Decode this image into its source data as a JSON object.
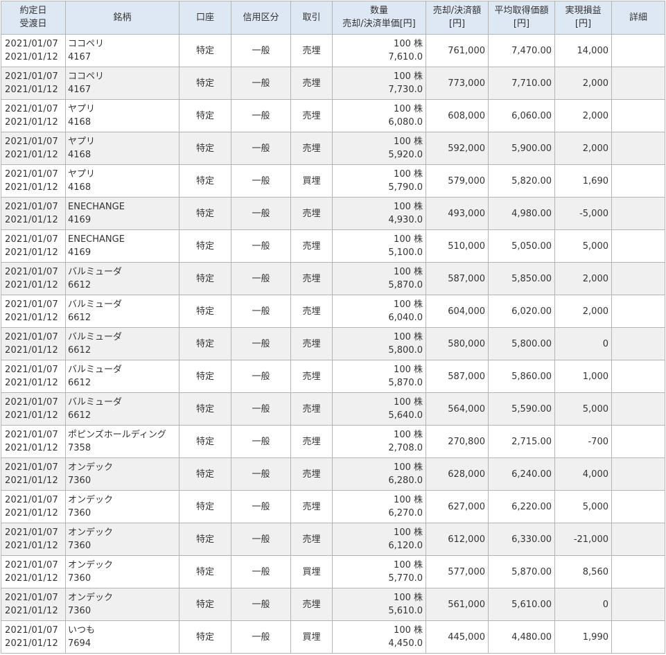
{
  "header": {
    "date_1": "約定日",
    "date_2": "受渡日",
    "name": "銘柄",
    "account": "口座",
    "credit": "信用区分",
    "trade": "取引",
    "qty_1": "数量",
    "qty_2": "売却/決済単価[円]",
    "amount_1": "売却/決済額",
    "amount_2": "[円]",
    "avg_1": "平均取得価額",
    "avg_2": "[円]",
    "pl_1": "実現損益",
    "pl_2": "[円]",
    "detail": "詳細"
  },
  "rows": [
    {
      "trade_date": "2021/01/07",
      "settle_date": "2021/01/12",
      "name": "ココペリ",
      "code": "4167",
      "account": "特定",
      "credit": "一般",
      "type": "売埋",
      "qty": "100 株",
      "price": "7,610.0",
      "amount": "761,000",
      "avg": "7,470.00",
      "pl": "14,000",
      "detail": ""
    },
    {
      "trade_date": "2021/01/07",
      "settle_date": "2021/01/12",
      "name": "ココペリ",
      "code": "4167",
      "account": "特定",
      "credit": "一般",
      "type": "売埋",
      "qty": "100 株",
      "price": "7,730.0",
      "amount": "773,000",
      "avg": "7,710.00",
      "pl": "2,000",
      "detail": ""
    },
    {
      "trade_date": "2021/01/07",
      "settle_date": "2021/01/12",
      "name": "ヤプリ",
      "code": "4168",
      "account": "特定",
      "credit": "一般",
      "type": "売埋",
      "qty": "100 株",
      "price": "6,080.0",
      "amount": "608,000",
      "avg": "6,060.00",
      "pl": "2,000",
      "detail": ""
    },
    {
      "trade_date": "2021/01/07",
      "settle_date": "2021/01/12",
      "name": "ヤプリ",
      "code": "4168",
      "account": "特定",
      "credit": "一般",
      "type": "売埋",
      "qty": "100 株",
      "price": "5,920.0",
      "amount": "592,000",
      "avg": "5,900.00",
      "pl": "2,000",
      "detail": ""
    },
    {
      "trade_date": "2021/01/07",
      "settle_date": "2021/01/12",
      "name": "ヤプリ",
      "code": "4168",
      "account": "特定",
      "credit": "一般",
      "type": "買埋",
      "qty": "100 株",
      "price": "5,790.0",
      "amount": "579,000",
      "avg": "5,820.00",
      "pl": "1,690",
      "detail": ""
    },
    {
      "trade_date": "2021/01/07",
      "settle_date": "2021/01/12",
      "name": "ENECHANGE",
      "code": "4169",
      "account": "特定",
      "credit": "一般",
      "type": "売埋",
      "qty": "100 株",
      "price": "4,930.0",
      "amount": "493,000",
      "avg": "4,980.00",
      "pl": "-5,000",
      "detail": ""
    },
    {
      "trade_date": "2021/01/07",
      "settle_date": "2021/01/12",
      "name": "ENECHANGE",
      "code": "4169",
      "account": "特定",
      "credit": "一般",
      "type": "売埋",
      "qty": "100 株",
      "price": "5,100.0",
      "amount": "510,000",
      "avg": "5,050.00",
      "pl": "5,000",
      "detail": ""
    },
    {
      "trade_date": "2021/01/07",
      "settle_date": "2021/01/12",
      "name": "バルミューダ",
      "code": "6612",
      "account": "特定",
      "credit": "一般",
      "type": "売埋",
      "qty": "100 株",
      "price": "5,870.0",
      "amount": "587,000",
      "avg": "5,850.00",
      "pl": "2,000",
      "detail": ""
    },
    {
      "trade_date": "2021/01/07",
      "settle_date": "2021/01/12",
      "name": "バルミューダ",
      "code": "6612",
      "account": "特定",
      "credit": "一般",
      "type": "売埋",
      "qty": "100 株",
      "price": "6,040.0",
      "amount": "604,000",
      "avg": "6,020.00",
      "pl": "2,000",
      "detail": ""
    },
    {
      "trade_date": "2021/01/07",
      "settle_date": "2021/01/12",
      "name": "バルミューダ",
      "code": "6612",
      "account": "特定",
      "credit": "一般",
      "type": "売埋",
      "qty": "100 株",
      "price": "5,800.0",
      "amount": "580,000",
      "avg": "5,800.00",
      "pl": "0",
      "detail": ""
    },
    {
      "trade_date": "2021/01/07",
      "settle_date": "2021/01/12",
      "name": "バルミューダ",
      "code": "6612",
      "account": "特定",
      "credit": "一般",
      "type": "売埋",
      "qty": "100 株",
      "price": "5,870.0",
      "amount": "587,000",
      "avg": "5,860.00",
      "pl": "1,000",
      "detail": ""
    },
    {
      "trade_date": "2021/01/07",
      "settle_date": "2021/01/12",
      "name": "バルミューダ",
      "code": "6612",
      "account": "特定",
      "credit": "一般",
      "type": "売埋",
      "qty": "100 株",
      "price": "5,640.0",
      "amount": "564,000",
      "avg": "5,590.00",
      "pl": "5,000",
      "detail": ""
    },
    {
      "trade_date": "2021/01/07",
      "settle_date": "2021/01/12",
      "name": "ポピンズホールディング",
      "code": "7358",
      "account": "特定",
      "credit": "一般",
      "type": "売埋",
      "qty": "100 株",
      "price": "2,708.0",
      "amount": "270,800",
      "avg": "2,715.00",
      "pl": "-700",
      "detail": ""
    },
    {
      "trade_date": "2021/01/07",
      "settle_date": "2021/01/12",
      "name": "オンデック",
      "code": "7360",
      "account": "特定",
      "credit": "一般",
      "type": "売埋",
      "qty": "100 株",
      "price": "6,280.0",
      "amount": "628,000",
      "avg": "6,240.00",
      "pl": "4,000",
      "detail": ""
    },
    {
      "trade_date": "2021/01/07",
      "settle_date": "2021/01/12",
      "name": "オンデック",
      "code": "7360",
      "account": "特定",
      "credit": "一般",
      "type": "売埋",
      "qty": "100 株",
      "price": "6,270.0",
      "amount": "627,000",
      "avg": "6,220.00",
      "pl": "5,000",
      "detail": ""
    },
    {
      "trade_date": "2021/01/07",
      "settle_date": "2021/01/12",
      "name": "オンデック",
      "code": "7360",
      "account": "特定",
      "credit": "一般",
      "type": "売埋",
      "qty": "100 株",
      "price": "6,120.0",
      "amount": "612,000",
      "avg": "6,330.00",
      "pl": "-21,000",
      "detail": ""
    },
    {
      "trade_date": "2021/01/07",
      "settle_date": "2021/01/12",
      "name": "オンデック",
      "code": "7360",
      "account": "特定",
      "credit": "一般",
      "type": "買埋",
      "qty": "100 株",
      "price": "5,770.0",
      "amount": "577,000",
      "avg": "5,870.00",
      "pl": "8,560",
      "detail": ""
    },
    {
      "trade_date": "2021/01/07",
      "settle_date": "2021/01/12",
      "name": "オンデック",
      "code": "7360",
      "account": "特定",
      "credit": "一般",
      "type": "売埋",
      "qty": "100 株",
      "price": "5,610.0",
      "amount": "561,000",
      "avg": "5,610.00",
      "pl": "0",
      "detail": ""
    },
    {
      "trade_date": "2021/01/07",
      "settle_date": "2021/01/12",
      "name": "いつも",
      "code": "7694",
      "account": "特定",
      "credit": "一般",
      "type": "買埋",
      "qty": "100 株",
      "price": "4,450.0",
      "amount": "445,000",
      "avg": "4,480.00",
      "pl": "1,990",
      "detail": ""
    }
  ]
}
